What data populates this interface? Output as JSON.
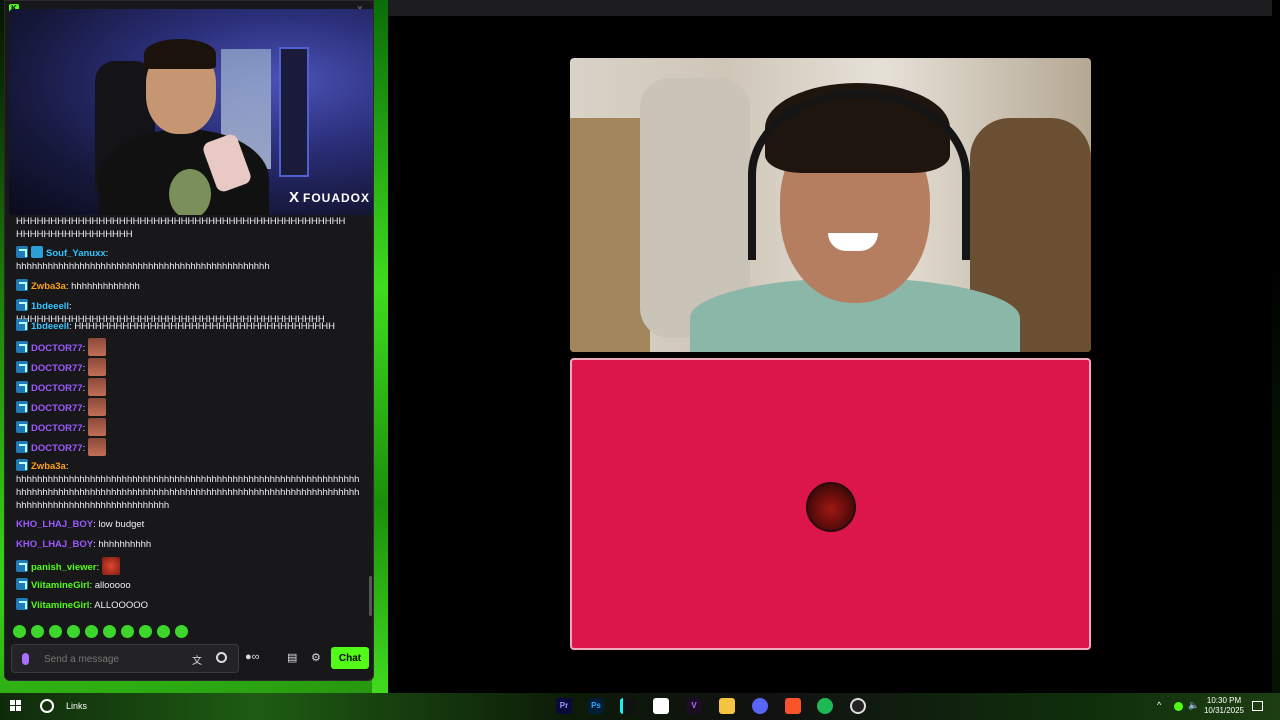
{
  "chat": {
    "window_icon": "kick-logo",
    "close_glyph": "×",
    "webcam_overlay": {
      "x_glyph": "X",
      "handle": "FOUADOX"
    },
    "messages": [
      {
        "user": "",
        "text": "HHHHHHHHHHHHHHHHHHHHHHHHHHHHHHHHHHHHHHHHHHHHHHHH HHHHHHHHHHHHHHHHH"
      },
      {
        "user": "Souf_Yanuxx",
        "text": "hhhhhhhhhhhhhhhhhhhhhhhhhhhhhhhhhhhhhhhhhhhhhhhh"
      },
      {
        "user": "Zwba3a",
        "text": "hhhhhhhhhhhhh"
      },
      {
        "user": "1bdeeell",
        "text": "HHHHHHHHHHHHHHHHHHHHHHHHHHHHHHHHHHHHHHHHHHHHH"
      },
      {
        "user": "1bdeeell",
        "text": "HHHHHHHHHHHHHHHHHHHHHHHHHHHHHHHHHHHHHH"
      },
      {
        "user": "DOCTOR77",
        "text": ""
      },
      {
        "user": "DOCTOR77",
        "text": ""
      },
      {
        "user": "DOCTOR77",
        "text": ""
      },
      {
        "user": "DOCTOR77",
        "text": ""
      },
      {
        "user": "DOCTOR77",
        "text": ""
      },
      {
        "user": "DOCTOR77",
        "text": ""
      },
      {
        "user": "Zwba3a",
        "text": "hhhhhhhhhhhhhhhhhhhhhhhhhhhhhhhhhhhhhhhhhhhhhhhhhhhhhhhhhhhhhhhhhhhhhhhhhhhhhhhhhhhhhhhhhhhhhhhhhhhhhhhhhhhhhhhhhhhhhhhhhhhhhhhhhhhhhhhhhhhhhhhhhhhhhhhhhhhhhhh"
      },
      {
        "user": "KHO_LHAJ_BOY",
        "text": "low budget"
      },
      {
        "user": "KHO_LHAJ_BOY",
        "text": "hhhhhhhhhh"
      },
      {
        "user": "panish_viewer",
        "text": ""
      },
      {
        "user": "ViitamineGirl",
        "text": "allooooo"
      },
      {
        "user": "ViitamineGirl",
        "text": "ALLOOOOO"
      }
    ],
    "input_placeholder": "Send a message",
    "chat_button": "Chat",
    "colors": {
      "accent": "#53fc18",
      "background": "#18181b"
    }
  },
  "taskbar": {
    "search_label": "Links",
    "apps": [
      "Pr",
      "Ps",
      "CapCut",
      "Camera",
      "Vegas",
      "Files",
      "Discord",
      "Brave",
      "Spotify",
      "OBS"
    ],
    "clock_time": "10:30 PM",
    "clock_date": "10/31/2025"
  },
  "viewer": {
    "panel_bg": "#dc164a"
  }
}
